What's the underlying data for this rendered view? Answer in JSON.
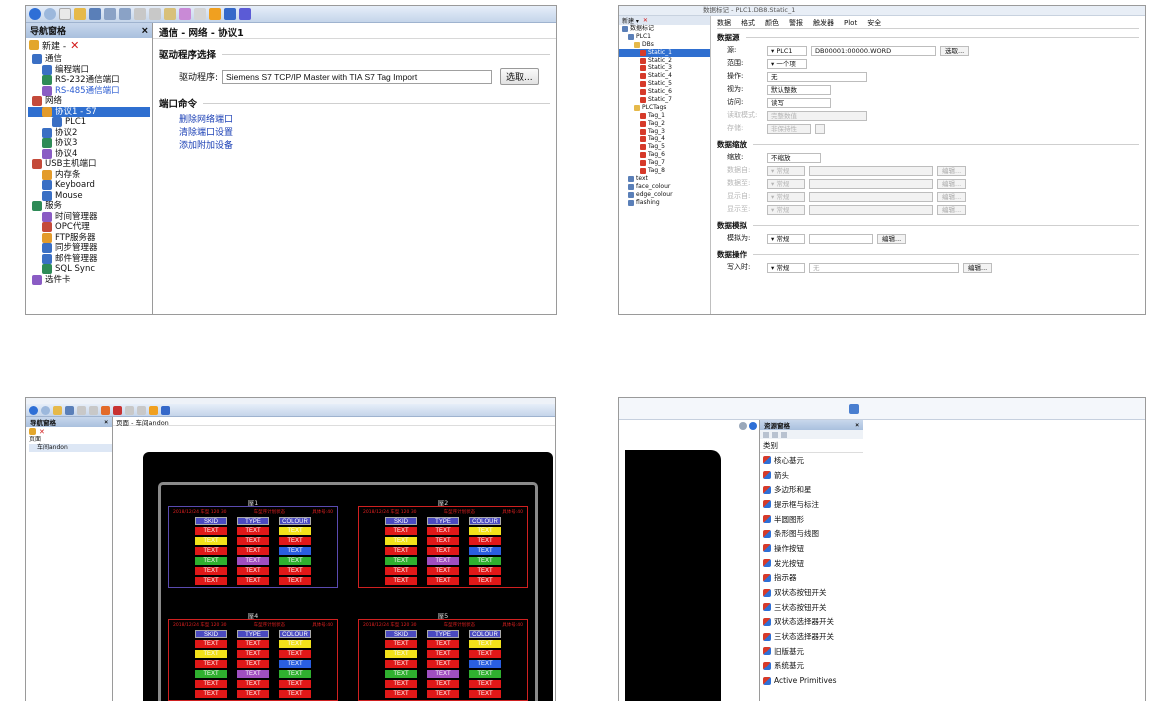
{
  "panel1": {
    "nav_title": "导航窗格",
    "close": "×",
    "new_label": "新建 - ",
    "tree": [
      {
        "label": "通信",
        "level": 0
      },
      {
        "label": "编程端口",
        "level": 1
      },
      {
        "label": "RS-232通信端口",
        "level": 1
      },
      {
        "label": "RS-485通信端口",
        "level": 1,
        "blue": true
      },
      {
        "label": "网络",
        "level": 0
      },
      {
        "label": "协议1 - S7",
        "level": 1,
        "selected": true
      },
      {
        "label": "PLC1",
        "level": 2
      },
      {
        "label": "协议2",
        "level": 1
      },
      {
        "label": "协议3",
        "level": 1
      },
      {
        "label": "协议4",
        "level": 1
      },
      {
        "label": "USB主机端口",
        "level": 0
      },
      {
        "label": "内存条",
        "level": 1
      },
      {
        "label": "Keyboard",
        "level": 1
      },
      {
        "label": "Mouse",
        "level": 1
      },
      {
        "label": "服务",
        "level": 0
      },
      {
        "label": "时间管理器",
        "level": 1
      },
      {
        "label": "OPC代理",
        "level": 1
      },
      {
        "label": "FTP服务器",
        "level": 1
      },
      {
        "label": "同步管理器",
        "level": 1
      },
      {
        "label": "邮件管理器",
        "level": 1
      },
      {
        "label": "SQL Sync",
        "level": 1
      },
      {
        "label": "选件卡",
        "level": 0
      }
    ],
    "breadcrumb": "通信 - 网络 - 协议1",
    "driver_section": "驱动程序选择",
    "driver_label": "驱动程序:",
    "driver_value": "Siemens S7 TCP/IP Master with TIA S7 Tag Import",
    "browse_button": "选取...",
    "port_section": "端口命令",
    "port_links": [
      "删除网络端口",
      "清除端口设置",
      "添加附加设备"
    ]
  },
  "panel2": {
    "title": "数据标记 - PLC1.DB8.Static_1",
    "tabs": [
      "数据",
      "格式",
      "颜色",
      "警报",
      "触发器",
      "Plot",
      "安全"
    ],
    "tree": [
      {
        "label": "数据标记",
        "level": 0
      },
      {
        "label": "PLC1",
        "level": 1
      },
      {
        "label": "DBs",
        "level": 2
      },
      {
        "label": "Static_1",
        "level": 3,
        "selected": true
      },
      {
        "label": "Static_2",
        "level": 3
      },
      {
        "label": "Static_3",
        "level": 3
      },
      {
        "label": "Static_4",
        "level": 3
      },
      {
        "label": "Static_5",
        "level": 3
      },
      {
        "label": "Static_6",
        "level": 3
      },
      {
        "label": "Static_7",
        "level": 3
      },
      {
        "label": "PLCTags",
        "level": 2
      },
      {
        "label": "Tag_1",
        "level": 3
      },
      {
        "label": "Tag_2",
        "level": 3
      },
      {
        "label": "Tag_3",
        "level": 3
      },
      {
        "label": "Tag_4",
        "level": 3
      },
      {
        "label": "Tag_5",
        "level": 3
      },
      {
        "label": "Tag_6",
        "level": 3
      },
      {
        "label": "Tag_7",
        "level": 3
      },
      {
        "label": "Tag_8",
        "level": 3
      },
      {
        "label": "text",
        "level": 1
      },
      {
        "label": "face_colour",
        "level": 1
      },
      {
        "label": "edge_colour",
        "level": 1
      },
      {
        "label": "flashing",
        "level": 1
      }
    ],
    "source_section": "数据源",
    "source_label": "源:",
    "source_value": "▾ PLC1",
    "source_addr": "DB00001:00000.WORD",
    "source_btn": "选取...",
    "range_label": "范围:",
    "range_value": "▾ 一个项",
    "op_label": "操作:",
    "op_value": "无",
    "treat_label": "视为:",
    "treat_value": "默认整数",
    "access_label": "访问:",
    "access_value": "读写",
    "read_label": "读取模式:",
    "read_value": "完整数值",
    "store_label": "存储:",
    "store_value": "非保持性",
    "scale_section": "数据缩放",
    "scale_label": "缩放:",
    "scale_value": "不缩放",
    "scale_rows": [
      "数据自:",
      "数据至:",
      "显示自:",
      "显示至:"
    ],
    "scale_dd": "▾ 常规",
    "scale_btn": "编辑...",
    "sim_section": "数据模拟",
    "sim_label": "模拟为:",
    "sim_value": "▾ 常规",
    "sim_btn": "编辑...",
    "act_section": "数据操作",
    "act_label": "写入时:",
    "act_value": "▾ 常规",
    "act_input": "无",
    "act_btn": "编辑..."
  },
  "panel3": {
    "nav_title": "导航窗格",
    "close": "×",
    "tree": [
      "页面",
      "车间andon"
    ],
    "breadcrumb": "页面 - 车间andon",
    "zones": [
      {
        "name": "屋1",
        "info": "2018/12/24 车型 120 30",
        "cols": [
          "SKID",
          "TYPE",
          "COLOUR"
        ]
      },
      {
        "name": "屋2",
        "info": "2018/12/24 车型 120 30",
        "cols": [
          "SKID",
          "TYPE",
          "COLOUR"
        ]
      },
      {
        "name": "屋4",
        "info": "2018/12/24 车型 120 30",
        "cols": [
          "SKID",
          "TYPE",
          "COLOUR"
        ]
      },
      {
        "name": "屋5",
        "info": "2018/12/24 车型 120 30",
        "cols": [
          "SKID",
          "TYPE",
          "COLOUR"
        ]
      }
    ],
    "header_labels": [
      "车型序计划状态",
      "具体号:40",
      "示例号:40"
    ],
    "cell_text": "TEXT"
  },
  "panel4": {
    "title": "资源窗格",
    "close": "×",
    "category": "类别",
    "items": [
      "核心基元",
      "箭头",
      "多边形和星",
      "提示框与标注",
      "半圆图形",
      "条形图与线图",
      "操作按钮",
      "发光按钮",
      "指示器",
      "双状态按钮开关",
      "三状态按钮开关",
      "双状态选择器开关",
      "三状态选择器开关",
      "旧版基元",
      "系统基元",
      "Active Primitives"
    ]
  },
  "colors": {
    "selection": "#2f6fd0",
    "link": "#1a3fb5",
    "canvas": "#000000",
    "cell_red": "#e01818",
    "cell_yellow": "#f2e21a",
    "cell_green": "#2fb02f",
    "cell_blue": "#2a5ee0",
    "cell_purple": "#a04fc0"
  }
}
